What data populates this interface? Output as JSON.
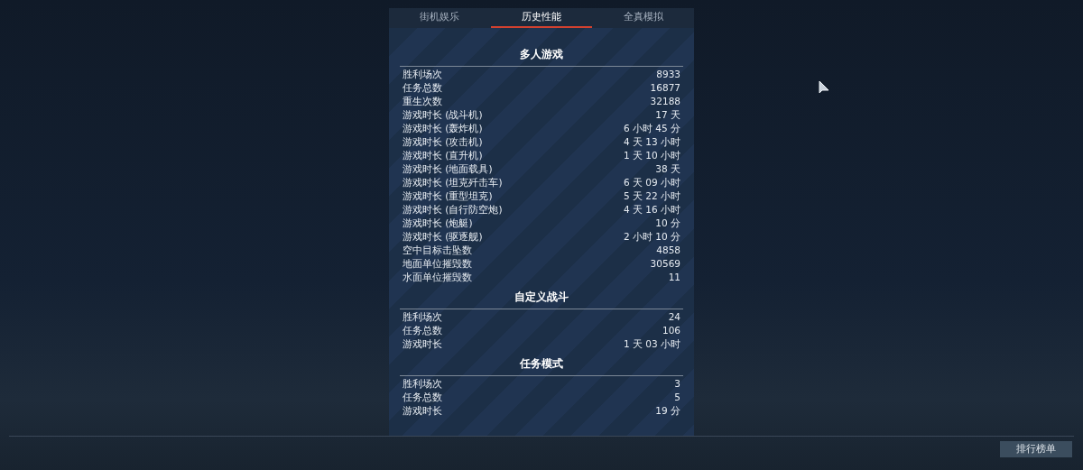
{
  "tabs": [
    {
      "label": "街机娱乐",
      "selected": false
    },
    {
      "label": "历史性能",
      "selected": true
    },
    {
      "label": "全真模拟",
      "selected": false
    }
  ],
  "sections": [
    {
      "title": "多人游戏",
      "rows": [
        {
          "label": "胜利场次",
          "value": "8933"
        },
        {
          "label": "任务总数",
          "value": "16877"
        },
        {
          "label": "重生次数",
          "value": "32188"
        },
        {
          "label": "游戏时长 (战斗机)",
          "value": "17 天"
        },
        {
          "label": "游戏时长 (轰炸机)",
          "value": "6 小时 45 分"
        },
        {
          "label": "游戏时长 (攻击机)",
          "value": "4 天 13 小时"
        },
        {
          "label": "游戏时长 (直升机)",
          "value": "1 天 10 小时"
        },
        {
          "label": "游戏时长 (地面载具)",
          "value": "38 天"
        },
        {
          "label": "游戏时长 (坦克歼击车)",
          "value": "6 天 09 小时"
        },
        {
          "label": "游戏时长 (重型坦克)",
          "value": "5 天 22 小时"
        },
        {
          "label": "游戏时长 (自行防空炮)",
          "value": "4 天 16 小时"
        },
        {
          "label": "游戏时长 (炮艇)",
          "value": "10 分"
        },
        {
          "label": "游戏时长 (驱逐舰)",
          "value": "2 小时 10 分"
        },
        {
          "label": "空中目标击坠数",
          "value": "4858"
        },
        {
          "label": "地面单位摧毁数",
          "value": "30569"
        },
        {
          "label": "水面单位摧毁数",
          "value": "11"
        }
      ]
    },
    {
      "title": "自定义战斗",
      "rows": [
        {
          "label": "胜利场次",
          "value": "24"
        },
        {
          "label": "任务总数",
          "value": "106"
        },
        {
          "label": "游戏时长",
          "value": "1 天 03 小时"
        }
      ]
    },
    {
      "title": "任务模式",
      "rows": [
        {
          "label": "胜利场次",
          "value": "3"
        },
        {
          "label": "任务总数",
          "value": "5"
        },
        {
          "label": "游戏时长",
          "value": "19 分"
        }
      ]
    }
  ],
  "leaderboard_button": "排行榜单"
}
